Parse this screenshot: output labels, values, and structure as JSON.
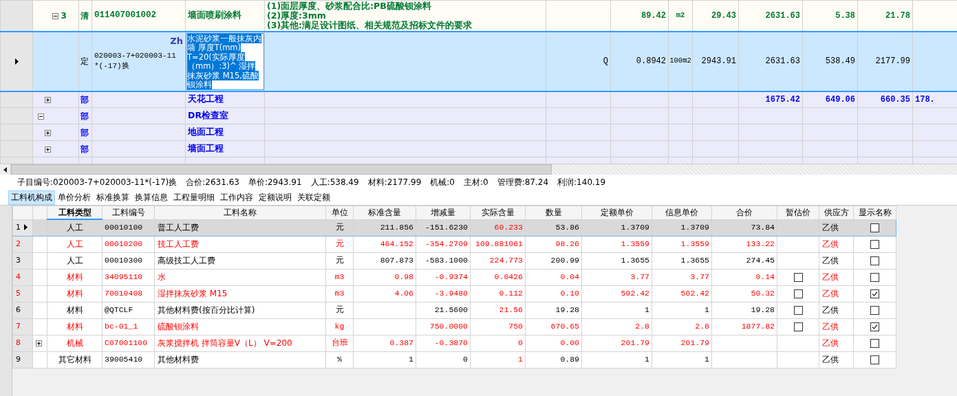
{
  "top_grid": {
    "rows": [
      {
        "children": [
          {
            "children": [
              {
                "kind": "qing",
                "expanded": true,
                "number": "3",
                "type": "清",
                "code": "011407001002",
                "name": "墙面喷刷涂料",
                "features": [
                  "(1)面层厚度、砂浆配合比:PB硫酸钡涂料",
                  "(2)厚度:3mm",
                  "(3)其他:满足设计图纸、相关规范及招标文件的要求"
                ],
                "quantity": "89.42",
                "unit": "m2",
                "unit_price": "29.43",
                "total": "2631.63",
                "labor": "5.38",
                "material": "21.78",
                "children": [
                  {
                    "kind": "ding",
                    "selected": true,
                    "type": "定",
                    "code": "020003-7+020003-11*(-17)换",
                    "badge": "Zh",
                    "name": "水泥砂浆一般抹灰内墙 厚度T(mm) T=20(实际厚度（mm）:3)^ 湿拌抹灰砂浆 M15,硫酸钡涂料",
                    "q": "Q",
                    "quantity": "0.8942",
                    "unit": "100m2",
                    "unit_price": "2943.91",
                    "total": "2631.63",
                    "labor": "538.49",
                    "material": "2177.99"
                  }
                ]
              }
            ]
          },
          {
            "kind": "bu",
            "expanded": false,
            "type": "部",
            "name": "天花工程",
            "total": "1675.42",
            "labor": "649.06",
            "material": "660.35",
            "extra": "178."
          }
        ]
      },
      {
        "kind": "bu",
        "expanded": true,
        "type": "部",
        "name": "DR检查室",
        "children": [
          {
            "kind": "bu",
            "expanded": false,
            "type": "部",
            "name": "地面工程"
          },
          {
            "kind": "bu",
            "expanded": false,
            "type": "部",
            "name": "墙面工程"
          }
        ]
      }
    ]
  },
  "summary": [
    "子目编号:020003-7+020003-11*(-17)换",
    "合价:2631.63",
    "单价:2943.91",
    "人工:538.49",
    "材料:2177.99",
    "机械:0",
    "主材:0",
    "管理费:87.24",
    "利润:140.19"
  ],
  "tabs": [
    {
      "label": "工料机构成",
      "selected": true
    },
    {
      "label": "单价分析",
      "selected": false
    },
    {
      "label": "标准换算",
      "selected": false
    },
    {
      "label": "换算信息",
      "selected": false
    },
    {
      "label": "工程量明细",
      "selected": false
    },
    {
      "label": "工作内容",
      "selected": false
    },
    {
      "label": "定额说明",
      "selected": false
    },
    {
      "label": "关联定额",
      "selected": false
    }
  ],
  "materials": {
    "columns": [
      {
        "label": "工料类型",
        "sorted": true
      },
      {
        "label": "工料编号"
      },
      {
        "label": "工料名称"
      },
      {
        "label": "单位"
      },
      {
        "label": "标准含量"
      },
      {
        "label": "增减量"
      },
      {
        "label": "实际含量",
        "highlight": true
      },
      {
        "label": "数量"
      },
      {
        "label": "定额单价"
      },
      {
        "label": "信息单价"
      },
      {
        "label": "合价"
      },
      {
        "label": "暂估价"
      },
      {
        "label": "供应方"
      },
      {
        "label": "显示名称"
      }
    ],
    "rows": [
      {
        "number": "1",
        "selected": true,
        "highlight": false,
        "cells": [
          "人工",
          "00010100",
          "普工人工费",
          "元",
          "211.856",
          "-151.6230",
          "60.233",
          "53.86",
          "1.3709",
          "1.3709",
          "73.84"
        ],
        "supplier": "乙供",
        "show_name": false
      },
      {
        "number": "2",
        "selected": false,
        "highlight": true,
        "cells": [
          "人工",
          "00010200",
          "技工人工费",
          "元",
          "464.152",
          "-354.2709",
          "109.881061",
          "98.26",
          "1.3559",
          "1.3559",
          "133.22"
        ],
        "supplier": "乙供",
        "show_name": false
      },
      {
        "number": "3",
        "selected": false,
        "highlight": false,
        "cells": [
          "人工",
          "00010300",
          "高级技工人工费",
          "元",
          "807.873",
          "-583.1000",
          "224.773",
          "200.99",
          "1.3655",
          "1.3655",
          "274.45"
        ],
        "supplier": "乙供",
        "show_name": false
      },
      {
        "number": "4",
        "selected": false,
        "highlight": true,
        "cells": [
          "材料",
          "34095110",
          "水",
          "m3",
          "0.98",
          "-0.9374",
          "0.0426",
          "0.04",
          "3.77",
          "3.77",
          "0.14"
        ],
        "estimate": false,
        "supplier": "乙供",
        "show_name": false
      },
      {
        "number": "5",
        "selected": false,
        "highlight": true,
        "cells": [
          "材料",
          "70010408",
          "湿拌抹灰砂浆 M15",
          "m3",
          "4.06",
          "-3.9480",
          "0.112",
          "0.10",
          "502.42",
          "502.42",
          "50.32"
        ],
        "estimate": false,
        "supplier": "乙供",
        "show_name": true
      },
      {
        "number": "6",
        "selected": false,
        "highlight": false,
        "cells": [
          "材料",
          "@QTCLF",
          "其他材料费(按百分比计算)",
          "元",
          null,
          "21.5600",
          "21.56",
          "19.28",
          "1",
          "1",
          "19.28"
        ],
        "estimate": false,
        "supplier": "乙供",
        "show_name": false
      },
      {
        "number": "7",
        "selected": false,
        "highlight": true,
        "cells": [
          "材料",
          "bc-01_1",
          "硫酸钡涂料",
          "kg",
          null,
          "750.0000",
          "750",
          "670.65",
          "2.8",
          "2.8",
          "1877.82"
        ],
        "estimate": false,
        "supplier": "乙供",
        "show_name": true
      },
      {
        "number": "8",
        "selected": false,
        "highlight": true,
        "expanded": false,
        "cells": [
          "机械",
          "C07001100",
          "灰浆搅拌机 拌筒容量V（L） V=200",
          "台班",
          "0.387",
          "-0.3870",
          "0",
          "0.00",
          "201.79",
          "201.79",
          null
        ],
        "supplier": "乙供",
        "show_name": false
      },
      {
        "number": "9",
        "selected": false,
        "highlight": false,
        "cells": [
          "其它材料",
          "39005410",
          "其他材料费",
          "%",
          "1",
          "0",
          "1",
          "0.89",
          "1",
          "1",
          null
        ],
        "supplier": "乙供",
        "show_name": false
      }
    ]
  }
}
